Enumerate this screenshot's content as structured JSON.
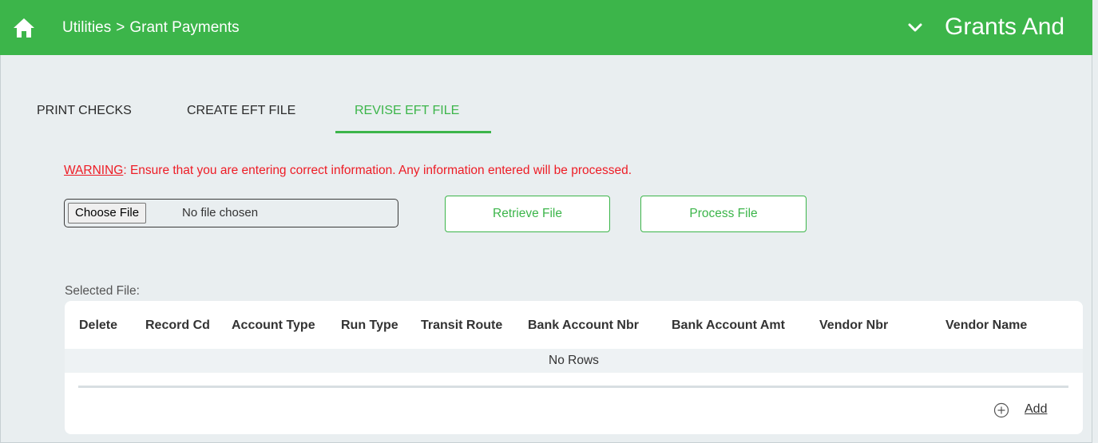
{
  "header": {
    "breadcrumb_parent": "Utilities",
    "breadcrumb_separator": ">",
    "breadcrumb_current": "Grant Payments",
    "module_title": "Grants And",
    "bar_color": "#3cb54a"
  },
  "tabs": [
    {
      "label": "PRINT CHECKS",
      "active": false
    },
    {
      "label": "CREATE EFT FILE",
      "active": false
    },
    {
      "label": "REVISE EFT FILE",
      "active": true
    }
  ],
  "warning": {
    "label": "WARNING",
    "message": ": Ensure that you are entering correct information. Any information entered will be processed.",
    "color": "#ee1c25"
  },
  "file_input": {
    "button_label": "Choose File",
    "status": "No file chosen"
  },
  "buttons": {
    "retrieve_label": "Retrieve File",
    "process_label": "Process File"
  },
  "selected_file_label": "Selected File:",
  "grid": {
    "columns": [
      "Delete",
      "Record Cd",
      "Account Type",
      "Run Type",
      "Transit Route",
      "Bank Account Nbr",
      "Bank Account Amt",
      "Vendor Nbr",
      "Vendor Name"
    ],
    "empty_text": "No Rows",
    "add_label": "Add"
  }
}
